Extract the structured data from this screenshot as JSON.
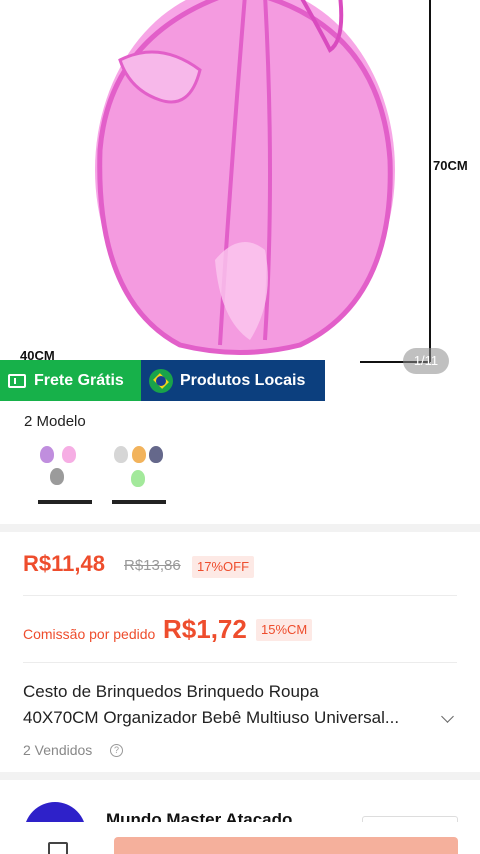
{
  "product_image": {
    "height_label": "70CM",
    "width_label": "40CM",
    "counter": "1/11"
  },
  "badges": {
    "free_shipping": "Frete Grátis",
    "local_products": "Produtos Locais"
  },
  "models": {
    "title": "2 Modelo"
  },
  "price": {
    "current": "R$11,48",
    "original": "R$13,86",
    "discount": "17%OFF"
  },
  "commission": {
    "label": "Comissão por pedido",
    "value": "R$1,72",
    "rate": "15%CM"
  },
  "product": {
    "title_line1": "Cesto de Brinquedos Brinquedo Roupa",
    "title_line2": "40X70CM Organizador Bebê Multiuso Universal...",
    "sold": "2 Vendidos"
  },
  "shop": {
    "name": "Mundo Master Atacado"
  },
  "colors": {
    "accent": "#ee4d2d",
    "free_shipping_bg": "#17b14a",
    "local_bg": "#0c3f7e",
    "product_pink": "#f48fd6"
  },
  "icons": [
    "ticket-icon",
    "brazil-flag-icon",
    "chevron-down-icon",
    "info-icon",
    "cart-icon"
  ]
}
